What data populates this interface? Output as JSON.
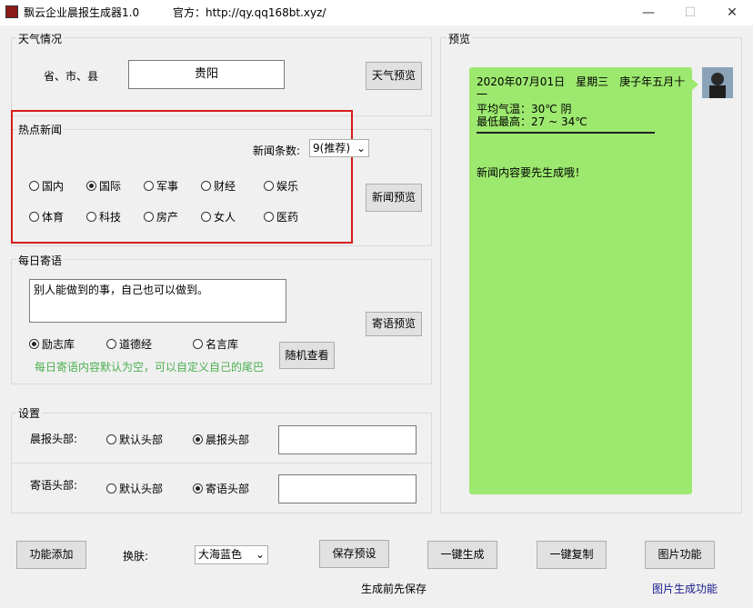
{
  "window": {
    "title": "飘云企业晨报生成器1.0",
    "official": "官方：http://qy.qq168bt.xyz/",
    "minimize_icon": "minimize-icon",
    "maximize_icon": "maximize-icon",
    "close_icon": "close-icon"
  },
  "weather": {
    "group_label": "天气情况",
    "location_label": "省、市、县",
    "location_value": "贵阳",
    "preview_button": "天气预览"
  },
  "news": {
    "group_label": "热点新闻",
    "count_label": "新闻条数:",
    "count_value": "9(推荐)",
    "categories": [
      {
        "label": "国内",
        "checked": false
      },
      {
        "label": "国际",
        "checked": true
      },
      {
        "label": "军事",
        "checked": false
      },
      {
        "label": "财经",
        "checked": false
      },
      {
        "label": "娱乐",
        "checked": false
      },
      {
        "label": "体育",
        "checked": false
      },
      {
        "label": "科技",
        "checked": false
      },
      {
        "label": "房产",
        "checked": false
      },
      {
        "label": "女人",
        "checked": false
      },
      {
        "label": "医药",
        "checked": false
      }
    ],
    "preview_button": "新闻预览"
  },
  "daily": {
    "group_label": "每日寄语",
    "text": "别人能做到的事，自己也可以做到。",
    "preview_button": "寄语预览",
    "sources": [
      {
        "label": "励志库",
        "checked": true
      },
      {
        "label": "道德经",
        "checked": false
      },
      {
        "label": "名言库",
        "checked": false
      }
    ],
    "random_button": "随机查看",
    "hint": "每日寄语内容默认为空，可以自定义自己的尾巴"
  },
  "settings": {
    "group_label": "设置",
    "morning_header_label": "晨报头部:",
    "morning_options": [
      {
        "label": "默认头部",
        "checked": false
      },
      {
        "label": "晨报头部",
        "checked": true
      }
    ],
    "quote_header_label": "寄语头部:",
    "quote_options": [
      {
        "label": "默认头部",
        "checked": false
      },
      {
        "label": "寄语头部",
        "checked": true
      }
    ]
  },
  "preview": {
    "group_label": "预览",
    "date_line": "2020年07月01日　星期三　庚子年五月十一",
    "avg_temp": "平均气温：30℃ 阴",
    "min_max": "最低最高：27 ~ 34℃",
    "news_placeholder": "新闻内容要先生成哦！",
    "bubble_color": "#9de86f"
  },
  "bottom": {
    "add_feature_button": "功能添加",
    "skin_label": "换肤:",
    "skin_value": "大海蓝色",
    "save_preset_button": "保存预设",
    "generate_button": "一键生成",
    "copy_button": "一键复制",
    "image_button": "图片功能",
    "save_note": "生成前先保存",
    "image_link": "图片生成功能"
  }
}
